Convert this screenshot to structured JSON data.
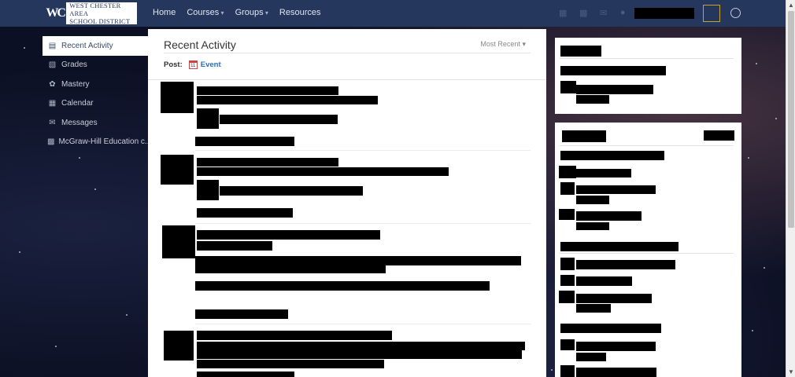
{
  "header": {
    "logo": {
      "mark": "WC",
      "line1": "WEST CHESTER AREA",
      "line2": "SCHOOL DISTRICT"
    },
    "nav": [
      {
        "label": "Home",
        "dropdown": false
      },
      {
        "label": "Courses",
        "dropdown": true
      },
      {
        "label": "Groups",
        "dropdown": true
      },
      {
        "label": "Resources",
        "dropdown": false
      }
    ],
    "icons": [
      "calendar-icon",
      "grid-icon",
      "inbox-icon",
      "notifications-icon",
      "help-icon"
    ]
  },
  "sidebar": {
    "items": [
      {
        "label": "Recent Activity",
        "icon": "activity-icon",
        "active": true
      },
      {
        "label": "Grades",
        "icon": "grades-icon",
        "active": false
      },
      {
        "label": "Mastery",
        "icon": "mastery-icon",
        "active": false
      },
      {
        "label": "Calendar",
        "icon": "calendar-icon",
        "active": false
      },
      {
        "label": "Messages",
        "icon": "messages-icon",
        "active": false
      },
      {
        "label": "McGraw-Hill Education c...",
        "icon": "app-icon",
        "active": false
      }
    ]
  },
  "feed": {
    "title": "Recent Activity",
    "sort_label": "Most Recent",
    "post_label": "Post:",
    "post_event_icon": "11",
    "post_event_label": "Event"
  },
  "colors": {
    "topbar": "#25375d",
    "accent_link": "#2a6ebb",
    "redaction": "#000000"
  }
}
